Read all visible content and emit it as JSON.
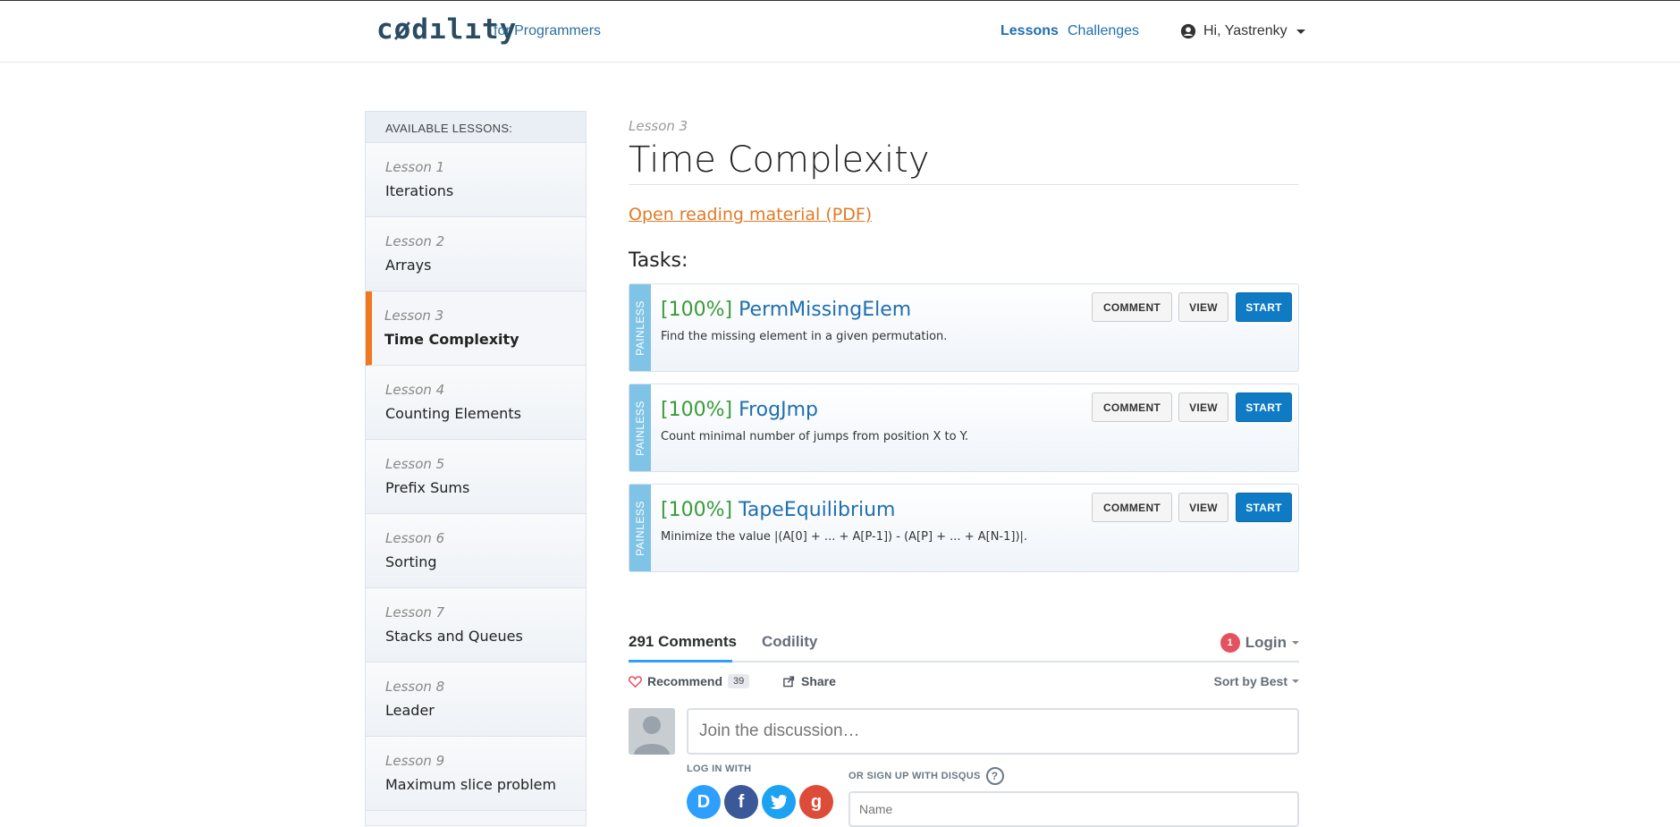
{
  "header": {
    "logo": "cødılıty",
    "tagline": "for Programmers",
    "nav_lessons": "Lessons",
    "nav_challenges": "Challenges",
    "user_greeting": "Hi, Yastrenky"
  },
  "sidebar": {
    "title": "AVAILABLE LESSONS:",
    "lessons": [
      {
        "num": "Lesson 1",
        "name": "Iterations"
      },
      {
        "num": "Lesson 2",
        "name": "Arrays"
      },
      {
        "num": "Lesson 3",
        "name": "Time Complexity"
      },
      {
        "num": "Lesson 4",
        "name": "Counting Elements"
      },
      {
        "num": "Lesson 5",
        "name": "Prefix Sums"
      },
      {
        "num": "Lesson 6",
        "name": "Sorting"
      },
      {
        "num": "Lesson 7",
        "name": "Stacks and Queues"
      },
      {
        "num": "Lesson 8",
        "name": "Leader"
      },
      {
        "num": "Lesson 9",
        "name": "Maximum slice problem"
      }
    ]
  },
  "main": {
    "lesson_label": "Lesson 3",
    "title": "Time Complexity",
    "pdf_link": "Open reading material (PDF)",
    "tasks_label": "Tasks:",
    "tasks": [
      {
        "difficulty": "PAINLESS",
        "score": "[100%]",
        "name": "PermMissingElem",
        "desc": "Find the missing element in a given permutation.",
        "comment": "COMMENT",
        "view": "VIEW",
        "start": "START"
      },
      {
        "difficulty": "PAINLESS",
        "score": "[100%]",
        "name": "FrogJmp",
        "desc": "Count minimal number of jumps from position X to Y.",
        "comment": "COMMENT",
        "view": "VIEW",
        "start": "START"
      },
      {
        "difficulty": "PAINLESS",
        "score": "[100%]",
        "name": "TapeEquilibrium",
        "desc": "Minimize the value |(A[0] + ... + A[P-1]) - (A[P] + ... + A[N-1])|.",
        "comment": "COMMENT",
        "view": "VIEW",
        "start": "START"
      }
    ]
  },
  "comments": {
    "count_tab": "291 Comments",
    "site_tab": "Codility",
    "login": "Login",
    "login_badge": "1",
    "recommend": "Recommend",
    "recommend_count": "39",
    "share": "Share",
    "sort": "Sort by Best",
    "discuss_placeholder": "Join the discussion…",
    "login_with": "LOG IN WITH",
    "signup_with": "OR SIGN UP WITH DISQUS",
    "help": "?",
    "name_placeholder": "Name",
    "social_disqus": "D",
    "social_facebook": "f",
    "social_google": "g"
  }
}
